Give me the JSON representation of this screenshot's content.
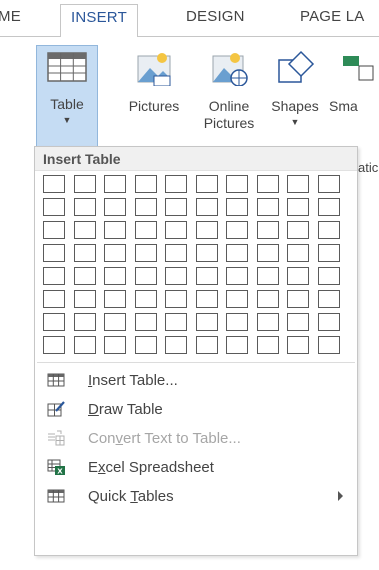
{
  "tabs": [
    {
      "label": "ME"
    },
    {
      "label": "INSERT"
    },
    {
      "label": "DESIGN"
    },
    {
      "label": "PAGE LA"
    }
  ],
  "ribbon": {
    "table": {
      "label": "Table"
    },
    "pictures": {
      "label": "Pictures"
    },
    "online_pictures": {
      "line1": "Online",
      "line2": "Pictures"
    },
    "shapes": {
      "label": "Shapes"
    },
    "smartart": {
      "label": "Sma"
    },
    "cut_text": {
      "label": "atic"
    }
  },
  "menu": {
    "header": "Insert Table",
    "grid": {
      "columns": 10,
      "rows": 8
    },
    "items": [
      {
        "pre": "",
        "u": "I",
        "post": "nsert Table...",
        "enabled": true,
        "icon": "insert-table-icon"
      },
      {
        "pre": "",
        "u": "D",
        "post": "raw Table",
        "enabled": true,
        "icon": "draw-table-icon"
      },
      {
        "pre": "Con",
        "u": "v",
        "post": "ert Text to Table...",
        "enabled": false,
        "icon": "convert-text-icon"
      },
      {
        "pre": "E",
        "u": "x",
        "post": "cel Spreadsheet",
        "enabled": true,
        "icon": "excel-spreadsheet-icon"
      },
      {
        "pre": "Quick ",
        "u": "T",
        "post": "ables",
        "enabled": true,
        "icon": "quick-tables-icon",
        "submenu": true
      }
    ]
  },
  "colors": {
    "accent": "#2b579a",
    "selected_button": "#c5dcf3",
    "excel_green": "#217346"
  }
}
